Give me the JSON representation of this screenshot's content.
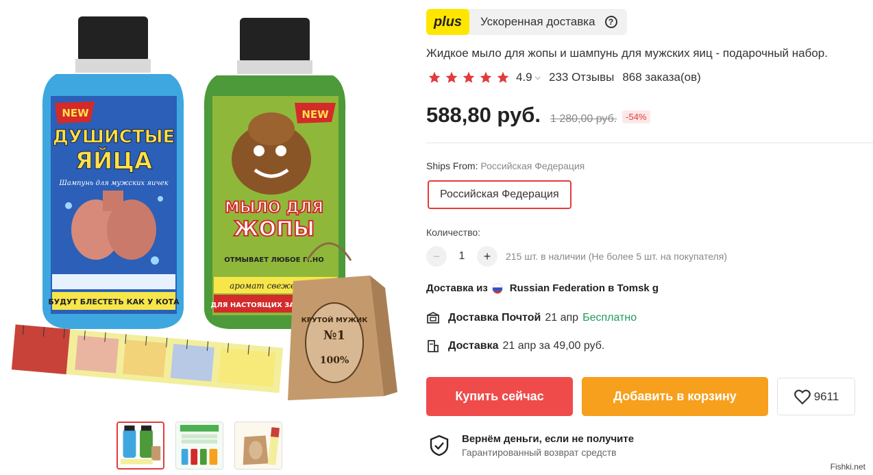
{
  "plus": {
    "badge": "plus",
    "text": "Ускоренная доставка",
    "help": "?"
  },
  "product": {
    "title": "Жидкое мыло для жопы и шампунь для мужских яиц - подарочный набор.",
    "rating": "4.9",
    "reviews": "233 Отзывы",
    "orders": "868 заказа(ов)",
    "stars_filled": 5,
    "price": "588,80 руб.",
    "old_price": "1 280,00 руб.",
    "discount": "-54%"
  },
  "images": {
    "bottle_left": {
      "badge": "NEW",
      "title_line1": "ДУШИСТЫЕ",
      "title_line2": "ЯЙЦА",
      "subtitle": "Шампунь для мужских яичек",
      "bottom": "БУДУТ БЛЕСТЕТЬ КАК У КОТА"
    },
    "bottle_right": {
      "badge": "NEW",
      "title_line1": "МЫЛО ДЛЯ",
      "title_line2": "ЖОПЫ",
      "middle": "ОТМЫВАЕТ ЛЮБОЕ Г..НО",
      "scent": "аромат свежести",
      "bottom": "ДЛЯ НАСТОЯЩИХ ЗАСРАНЦЕВ"
    },
    "bag": {
      "label1": "КРУТОЙ МУЖИК",
      "label2": "№1",
      "label3": "100%"
    }
  },
  "shipping": {
    "ships_from_label": "Ships From:",
    "ships_from_value": "Российская Федерация",
    "option": "Российская Федерация"
  },
  "quantity": {
    "label": "Количество:",
    "minus": "−",
    "value": "1",
    "plus": "+",
    "stock": "215 шт. в наличии (Не более 5 шт. на покупателя)"
  },
  "delivery": {
    "from_prefix": "Доставка из",
    "from_rest": "Russian Federation в Tomsk g",
    "post_label": "Доставка Почтой",
    "post_date": "21 апр",
    "post_price": "Бесплатно",
    "courier_label": "Доставка",
    "courier_rest": "21 апр за 49,00 руб."
  },
  "actions": {
    "buy": "Купить сейчас",
    "cart": "Добавить в корзину",
    "wish_count": "9611"
  },
  "guarantee": {
    "title": "Вернём деньги, если не получите",
    "subtitle": "Гарантированный возврат средств"
  },
  "watermark": "Fishki.net",
  "colors": {
    "accent_red": "#f04b4b",
    "accent_orange": "#f7a01d",
    "plus_yellow": "#ffe600",
    "star": "#e23b3b",
    "free_green": "#1e9a5b"
  }
}
